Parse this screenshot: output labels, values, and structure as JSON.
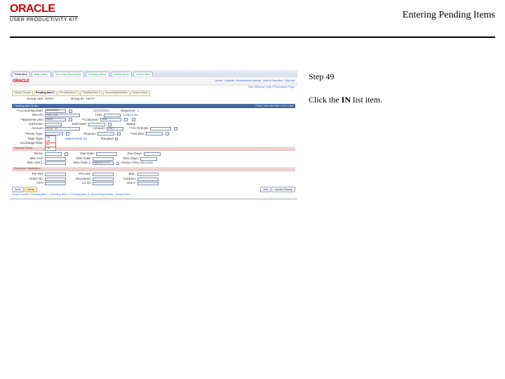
{
  "header": {
    "logo_text": "ORACLE",
    "logo_sub": "USER PRODUCTIVITY KIT",
    "title": "Entering Pending Items"
  },
  "instruction": {
    "step_label": "Step 49",
    "text_before": "Click the ",
    "bold_word": "IN",
    "text_after": " list item."
  },
  "mini": {
    "top_tabs": [
      "Favorites",
      "Main Menu",
      "Accounts Receivable",
      "Pending Items",
      "Online Items",
      "Online Item"
    ],
    "brand": "ORACLE",
    "crumbs": [
      "Home",
      "Worklist",
      "Performance Monitor",
      "Add to Favorites",
      "Sign out"
    ],
    "new_window": "New Window | Help | Personalize Page",
    "subtabs": [
      "Group Control",
      "Pending Item 1",
      "Pending Item 2",
      "Pending Item 3",
      "Accounting Entries",
      "Group Action"
    ],
    "group_row": {
      "group_unit_lbl": "Group Unit:",
      "group_unit_val": "00007",
      "group_id_lbl": "Group ID:",
      "group_id_val": "NEXT"
    },
    "sect1_title": "Pending Item Entry",
    "sect1_tools": "Find | View All    First  1 of 1  Last",
    "rows": {
      "acctg_date": {
        "lbl": "*Accounting Date:",
        "val": "11/04/2013"
      },
      "acctg_date2": {
        "lbl": "11/04/2013"
      },
      "sequence": {
        "lbl": "Sequence:",
        "val": "1"
      },
      "item_id": {
        "lbl": "Item ID:",
        "val": "INVC-445"
      },
      "line": {
        "lbl": "Line:"
      },
      "copy_line": "Copy Line",
      "bu": {
        "lbl": "*Business Unit:",
        "val": "00003"
      },
      "customer": {
        "lbl": "*Customer:",
        "val": "1000"
      },
      "subcust1": {
        "lbl": "SubCust1:"
      },
      "subcust2": {
        "lbl": "SubCust2:"
      },
      "status": {
        "lbl": "Status"
      },
      "amount": {
        "lbl": "Amount:",
        "val": "65,327.91"
      },
      "amount2": {
        "lbl": "Amount:",
        "val": "USD"
      },
      "asof": {
        "lbl": "*As Of Date:"
      },
      "entry_type": {
        "lbl": "*Entry Type:"
      },
      "reason": {
        "lbl": "Reason:"
      },
      "ar_dist": {
        "lbl": "*AR Dist:"
      },
      "rate_type": {
        "lbl": "Rate Type:"
      },
      "exch_rate": {
        "lbl": "Exchange Rate:"
      },
      "attachments": {
        "lbl": "Attachments (0)"
      },
      "revalue": {
        "lbl": "Revalue:"
      }
    },
    "dropdown_options": [
      "",
      "CR",
      "DR",
      "IN",
      "OA"
    ],
    "group_payment": "Payment Terms",
    "pay_rows": {
      "terms": {
        "lbl": "Terms:"
      },
      "due_date": {
        "lbl": "Due Date:"
      },
      "due_days": {
        "lbl": "Due Days:"
      },
      "disc_amt": {
        "lbl": "Disc Amt:"
      },
      "disc_date": {
        "lbl": "Disc Date:"
      },
      "disc_days": {
        "lbl": "Disc Days:"
      },
      "disc_amt1": {
        "lbl": "Disc Amt 1:"
      },
      "disc_date1": {
        "lbl": "Disc Date 1:",
        "val": "MM/DD/YYYY"
      },
      "allow_disc": {
        "lbl": "Always Allow Discount"
      }
    },
    "group_ref": "Reference Information",
    "ref_rows": {
      "po_ref": {
        "lbl": "PO Ref:"
      },
      "po_line": {
        "lbl": "PO Line:"
      },
      "bol": {
        "lbl": "BOL:"
      },
      "order_no": {
        "lbl": "Order No:"
      },
      "document": {
        "lbl": "Document:"
      },
      "contract": {
        "lbl": "Contract:"
      },
      "cfi": {
        "lbl": "CF/I:"
      },
      "lc_id": {
        "lbl": "LC ID:"
      },
      "link": {
        "lbl": "Link #:"
      }
    },
    "btn_save": "Save",
    "btn_notify": "Notify",
    "btn_add": "Add",
    "btn_update": "Update/Display",
    "footer_crumbs": [
      "Group Control",
      "Pending Item 1",
      "Pending Item 2",
      "Pending Item 3",
      "Accounting Entries",
      "Group Action"
    ]
  }
}
